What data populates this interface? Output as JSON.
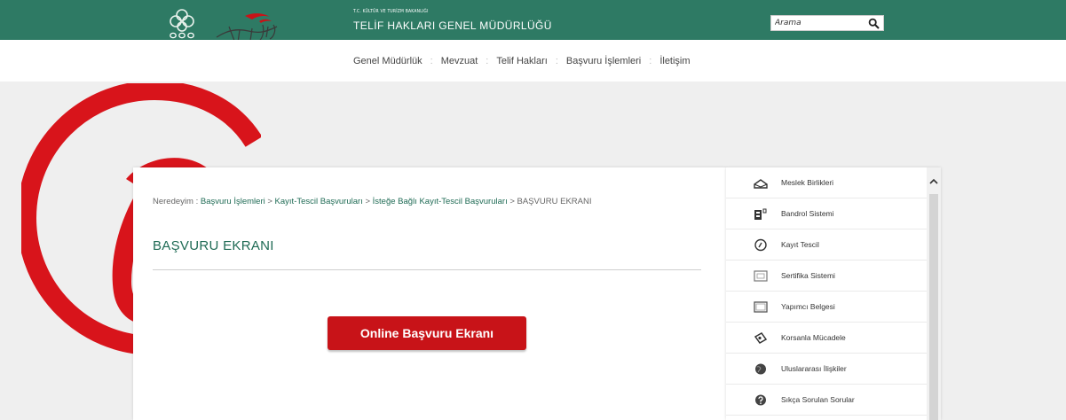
{
  "header": {
    "ministry": "T.C. KÜLTÜR VE TURİZM BAKANLIĞI",
    "agency": "TELİF HAKLARI GENEL MÜDÜRLÜĞÜ",
    "search_placeholder": "Arama"
  },
  "nav": {
    "items": [
      "Genel Müdürlük",
      "Mevzuat",
      "Telif Hakları",
      "Başvuru İşlemleri",
      "İletişim"
    ],
    "separator": ":"
  },
  "breadcrumb": {
    "prefix": "Neredeyim : ",
    "links": [
      "Başvuru İşlemleri",
      "Kayıt-Tescil Başvuruları",
      "İsteğe Bağlı Kayıt-Tescil Başvuruları"
    ],
    "separator": " > ",
    "current": "BAŞVURU EKRANI"
  },
  "page": {
    "title": "BAŞVURU EKRANI",
    "online_button": "Online Başvuru Ekranı"
  },
  "sidebar": {
    "items": [
      {
        "label": "Meslek Birlikleri",
        "icon": "meslek-birlikleri-icon"
      },
      {
        "label": "Bandrol Sistemi",
        "icon": "bandrol-icon"
      },
      {
        "label": "Kayıt Tescil",
        "icon": "kayit-tescil-icon"
      },
      {
        "label": "Sertifika Sistemi",
        "icon": "sertifika-icon"
      },
      {
        "label": "Yapımcı Belgesi",
        "icon": "yapimci-belgesi-icon"
      },
      {
        "label": "Korsanla Mücadele",
        "icon": "korsan-icon"
      },
      {
        "label": "Uluslararası İlişkiler",
        "icon": "globe-icon"
      },
      {
        "label": "Sıkça Sorulan Sorular",
        "icon": "question-icon"
      }
    ]
  },
  "colors": {
    "brand_green": "#2e7a64",
    "accent_red": "#c81318",
    "link_green": "#1f6b55"
  }
}
